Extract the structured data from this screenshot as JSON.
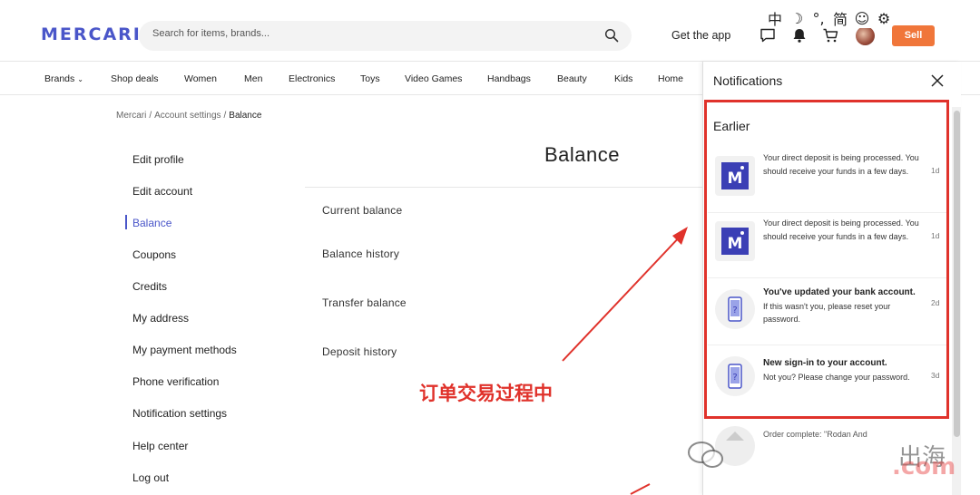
{
  "header": {
    "logo": "MERCARI",
    "search_placeholder": "Search for items, brands...",
    "get_app": "Get the app",
    "sell": "Sell"
  },
  "overlay_tools": [
    "中",
    "☽",
    "°,",
    "简",
    "☺",
    "⚙"
  ],
  "categories": [
    "Brands",
    "Shop deals",
    "Women",
    "Men",
    "Electronics",
    "Toys",
    "Video Games",
    "Handbags",
    "Beauty",
    "Kids",
    "Home"
  ],
  "breadcrumb": {
    "home": "Mercari",
    "section": "Account settings",
    "current": "Balance"
  },
  "sidebar": {
    "items": [
      {
        "label": "Edit profile"
      },
      {
        "label": "Edit account"
      },
      {
        "label": "Balance"
      },
      {
        "label": "Coupons"
      },
      {
        "label": "Credits"
      },
      {
        "label": "My address"
      },
      {
        "label": "My payment methods"
      },
      {
        "label": "Phone verification"
      },
      {
        "label": "Notification settings"
      },
      {
        "label": "Help center"
      },
      {
        "label": "Log out"
      }
    ],
    "active": "Balance"
  },
  "main": {
    "title": "Balance",
    "rows": [
      "Current balance",
      "Balance history",
      "Transfer balance",
      "Deposit history"
    ]
  },
  "annotation": "订单交易过程中",
  "notifications": {
    "title": "Notifications",
    "section": "Earlier",
    "items": [
      {
        "title": "",
        "body": "Your direct deposit is being processed. You should receive your funds in a few days.",
        "age": "1d",
        "icon": "mercari-logo-icon"
      },
      {
        "title": "",
        "body": "Your direct deposit is being processed. You should receive your funds in a few days.",
        "age": "1d",
        "icon": "mercari-logo-icon"
      },
      {
        "title": "You've updated your bank account.",
        "body": "If this wasn't you, please reset your password.",
        "age": "2d",
        "icon": "phone-icon"
      },
      {
        "title": "New sign-in to your account.",
        "body": "Not you? Please change your password.",
        "age": "3d",
        "icon": "phone-icon"
      },
      {
        "title": "",
        "body": "Order complete: \"Rodan And",
        "age": "",
        "icon": "item-icon"
      }
    ]
  },
  "watermark": {
    "cn": "出海",
    "site": ".com"
  },
  "colors": {
    "brand": "#4a56c9",
    "sell": "#f0763a",
    "annotation": "#e0322b"
  }
}
